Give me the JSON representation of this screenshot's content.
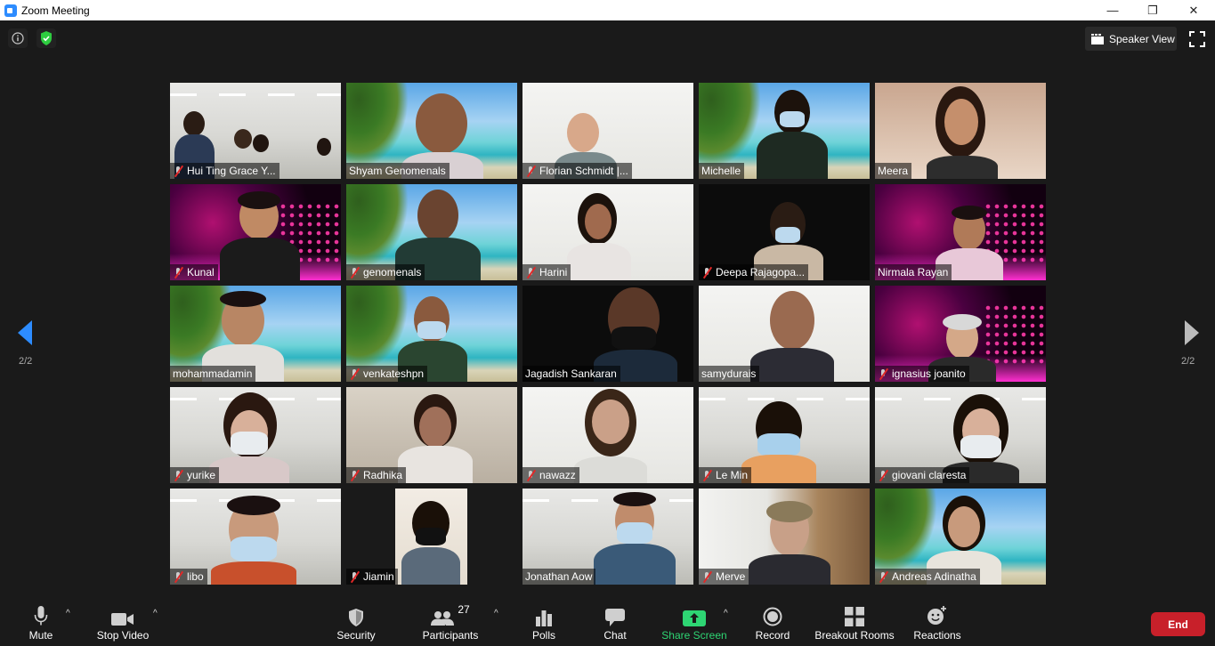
{
  "window": {
    "title": "Zoom Meeting",
    "minimize": "—",
    "restore": "❐",
    "close": "✕"
  },
  "header": {
    "speaker_view_label": "Speaker View"
  },
  "pagination": {
    "left_label": "2/2",
    "right_label": "2/2"
  },
  "participants": [
    {
      "name": "Hui Ting Grace Y...",
      "muted": true
    },
    {
      "name": "Shyam Genomenals",
      "muted": false
    },
    {
      "name": "Florian Schmidt |...",
      "muted": true
    },
    {
      "name": "Michelle",
      "muted": false
    },
    {
      "name": "Meera",
      "muted": false
    },
    {
      "name": "Kunal",
      "muted": true
    },
    {
      "name": "genomenals",
      "muted": true
    },
    {
      "name": "Harini",
      "muted": true
    },
    {
      "name": "Deepa Rajagopa...",
      "muted": true
    },
    {
      "name": "Nirmala Rayan",
      "muted": false
    },
    {
      "name": "mohammadamin",
      "muted": false
    },
    {
      "name": "venkateshpn",
      "muted": true
    },
    {
      "name": "Jagadish Sankaran",
      "muted": false
    },
    {
      "name": "samydurais",
      "muted": false
    },
    {
      "name": "ignasius joanito",
      "muted": true
    },
    {
      "name": "yurike",
      "muted": true
    },
    {
      "name": "Radhika",
      "muted": true
    },
    {
      "name": "nawazz",
      "muted": true
    },
    {
      "name": "Le Min",
      "muted": true
    },
    {
      "name": "giovani claresta",
      "muted": true
    },
    {
      "name": "libo",
      "muted": true
    },
    {
      "name": "Jiamin",
      "muted": true
    },
    {
      "name": "Jonathan Aow",
      "muted": false
    },
    {
      "name": "Merve",
      "muted": true
    },
    {
      "name": "Andreas Adinatha",
      "muted": true
    }
  ],
  "toolbar": {
    "mute": "Mute",
    "stop_video": "Stop Video",
    "security": "Security",
    "participants": "Participants",
    "participants_count": "27",
    "polls": "Polls",
    "chat": "Chat",
    "share_screen": "Share Screen",
    "record": "Record",
    "breakout_rooms": "Breakout Rooms",
    "reactions": "Reactions",
    "end": "End"
  },
  "colors": {
    "accent": "#2d8cff",
    "share": "#2ed573",
    "end": "#c8202a",
    "muted_mic": "#e02828"
  }
}
